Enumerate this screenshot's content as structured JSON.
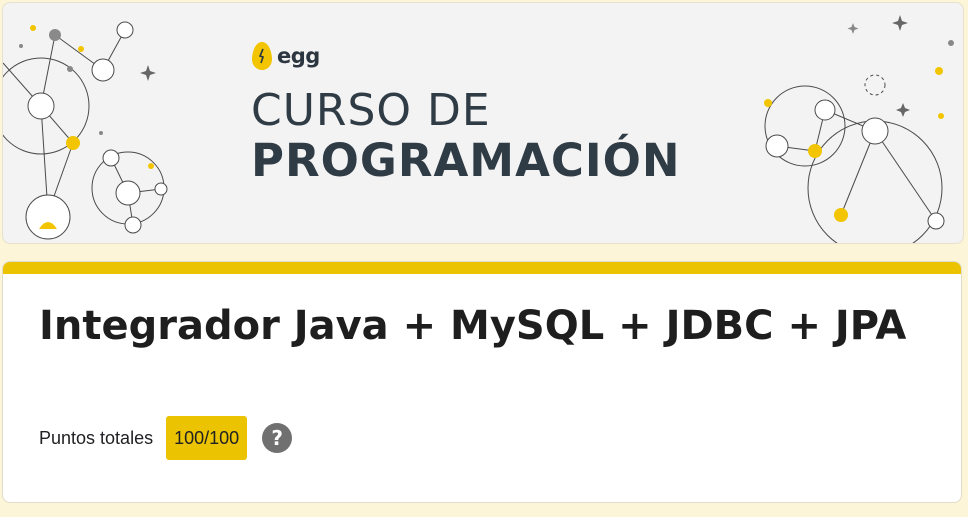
{
  "banner": {
    "brand_name": "egg",
    "title_line1": "CURSO DE",
    "title_line2": "PROGRAMACIÓN",
    "brand_color": "#f2c500"
  },
  "form": {
    "title": "Integrador Java + MySQL + JDBC + JPA",
    "points_label": "Puntos totales",
    "points_value": "100/100",
    "help_icon": "question-mark-icon",
    "accent_color": "#ebc300"
  }
}
